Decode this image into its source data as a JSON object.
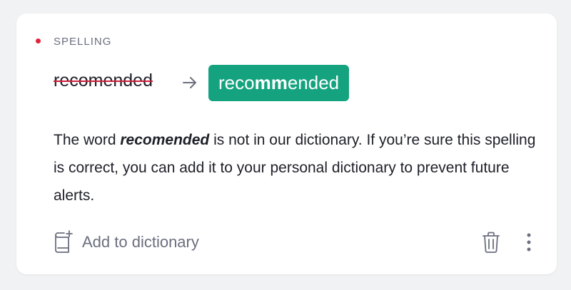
{
  "card": {
    "category": "SPELLING",
    "category_color": "#e0243a",
    "original_word": "recomended",
    "suggestion": {
      "prefix": "reco",
      "highlight": "mm",
      "suffix": "ended",
      "color": "#15a37f"
    },
    "description": {
      "before": "The word ",
      "word": "recomended",
      "after": " is not in our dictionary. If you’re sure this spelling is correct, you can add it to your personal dictionary to prevent future alerts."
    },
    "actions": {
      "add_to_dictionary": "Add to dictionary",
      "add_icon": "add-to-dictionary-icon",
      "delete_icon": "trash-icon",
      "more_icon": "more-vertical-icon"
    }
  }
}
